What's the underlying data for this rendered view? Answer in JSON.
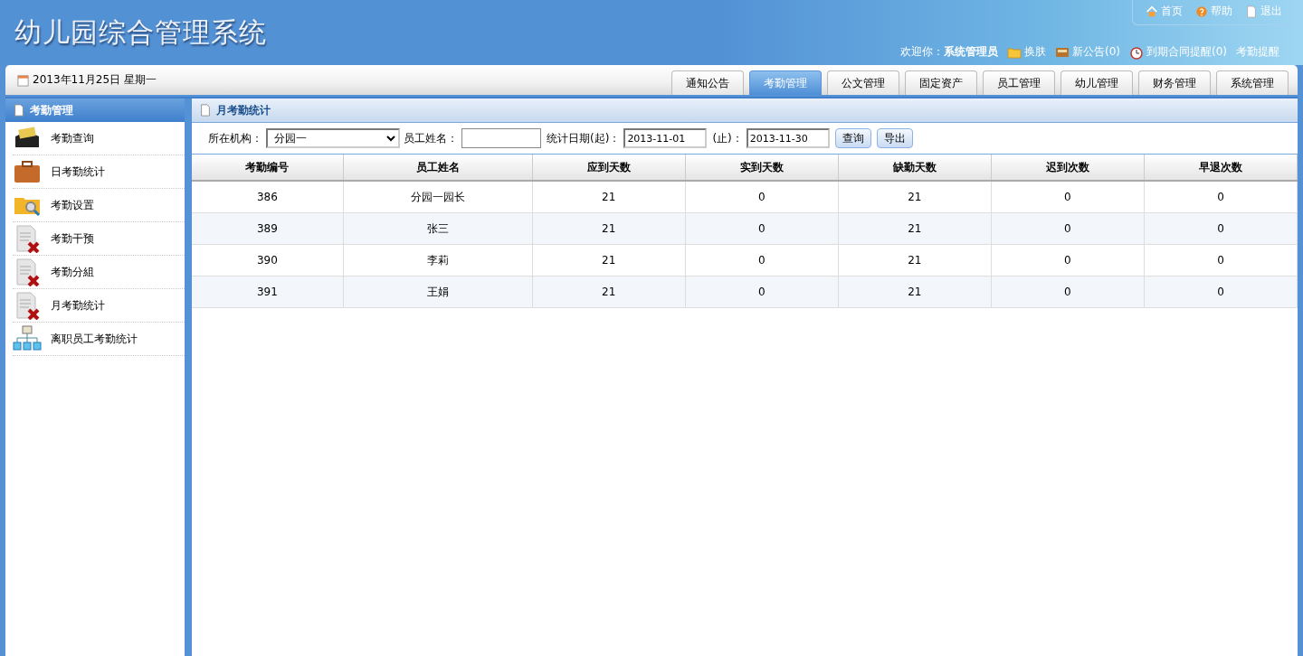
{
  "header": {
    "title": "幼儿园综合管理系统",
    "top_links": [
      "首页",
      "帮助",
      "退出"
    ],
    "welcome": {
      "prefix": "欢迎你：",
      "user": "系统管理员"
    },
    "notices": [
      "换肤",
      "新公告(0)",
      "到期合同提醒(0)",
      "考勤提醒"
    ]
  },
  "date_bar": {
    "date": "2013年11月25日 星期一"
  },
  "tabs": [
    {
      "label": "通知公告",
      "selected": false
    },
    {
      "label": "考勤管理",
      "selected": true
    },
    {
      "label": "公文管理",
      "selected": false
    },
    {
      "label": "固定资产",
      "selected": false
    },
    {
      "label": "员工管理",
      "selected": false
    },
    {
      "label": "幼儿管理",
      "selected": false
    },
    {
      "label": "财务管理",
      "selected": false
    },
    {
      "label": "系统管理",
      "selected": false
    }
  ],
  "sidebar": {
    "title": "考勤管理",
    "items": [
      "考勤查询",
      "日考勤统计",
      "考勤设置",
      "考勤干预",
      "考勤分組",
      "月考勤统计",
      "离职员工考勤统计"
    ]
  },
  "panel": {
    "title": "月考勤统计",
    "filters": {
      "org_label": "所在机构：",
      "org_value": "分园一",
      "name_label": "员工姓名：",
      "start_label": "统计日期(起)：",
      "start_value": "2013-11-01",
      "end_label": "(止)：",
      "end_value": "2013-11-30"
    },
    "buttons": [
      "查询",
      "导出"
    ],
    "table": {
      "columns": [
        "考勤编号",
        "员工姓名",
        "应到天数",
        "实到天数",
        "缺勤天数",
        "迟到次数",
        "早退次数"
      ],
      "rows": [
        [
          "386",
          "分园一园长",
          "21",
          "0",
          "21",
          "0",
          "0"
        ],
        [
          "389",
          "张三",
          "21",
          "0",
          "21",
          "0",
          "0"
        ],
        [
          "390",
          "李莉",
          "21",
          "0",
          "21",
          "0",
          "0"
        ],
        [
          "391",
          "王娟",
          "21",
          "0",
          "21",
          "0",
          "0"
        ]
      ]
    }
  }
}
